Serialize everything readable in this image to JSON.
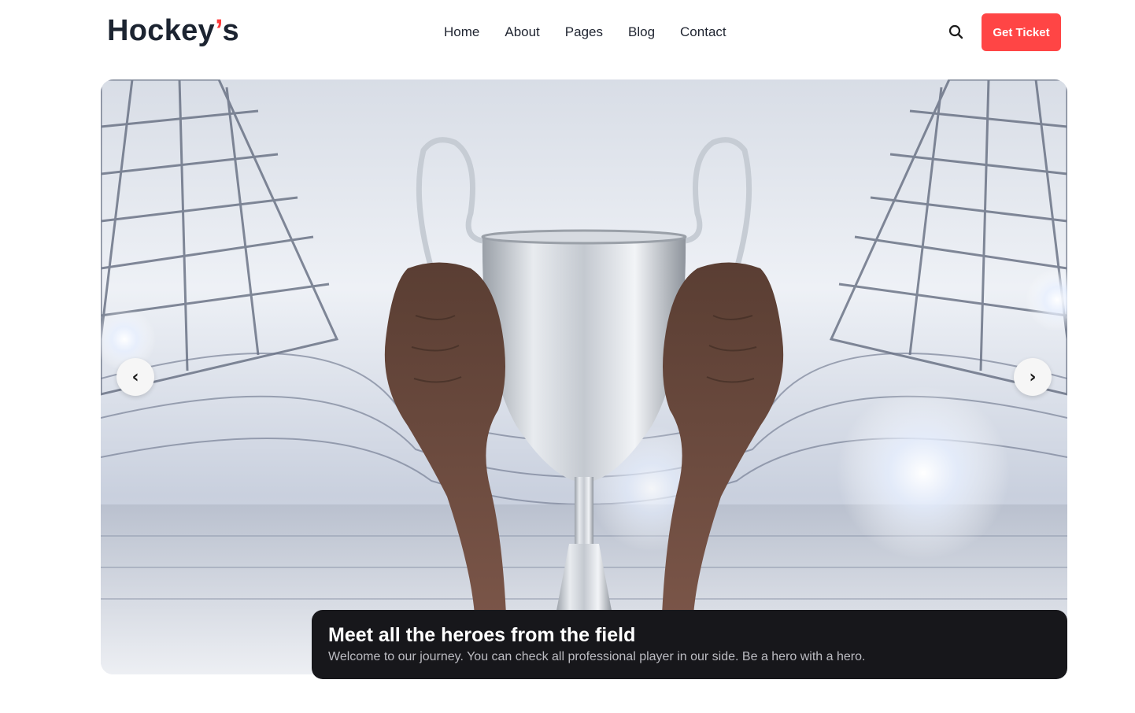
{
  "brand": {
    "name": "Hockey",
    "apostrophe": "’",
    "suffix": "s"
  },
  "nav": {
    "items": [
      {
        "label": "Home"
      },
      {
        "label": "About"
      },
      {
        "label": "Pages"
      },
      {
        "label": "Blog"
      },
      {
        "label": "Contact"
      }
    ]
  },
  "header": {
    "search_icon": "search-icon",
    "cta_label": "Get Ticket"
  },
  "hero": {
    "image": "trophy-held-in-stadium",
    "prev_label": "‹",
    "next_label": "›",
    "caption": {
      "title": "Meet all the heroes from the field",
      "subtitle": "Welcome to our journey. You can check all professional player in our side. Be a hero with a hero."
    }
  },
  "colors": {
    "accent": "#ff4545",
    "logo_text": "#1c2431",
    "caption_bg": "#17171b"
  }
}
